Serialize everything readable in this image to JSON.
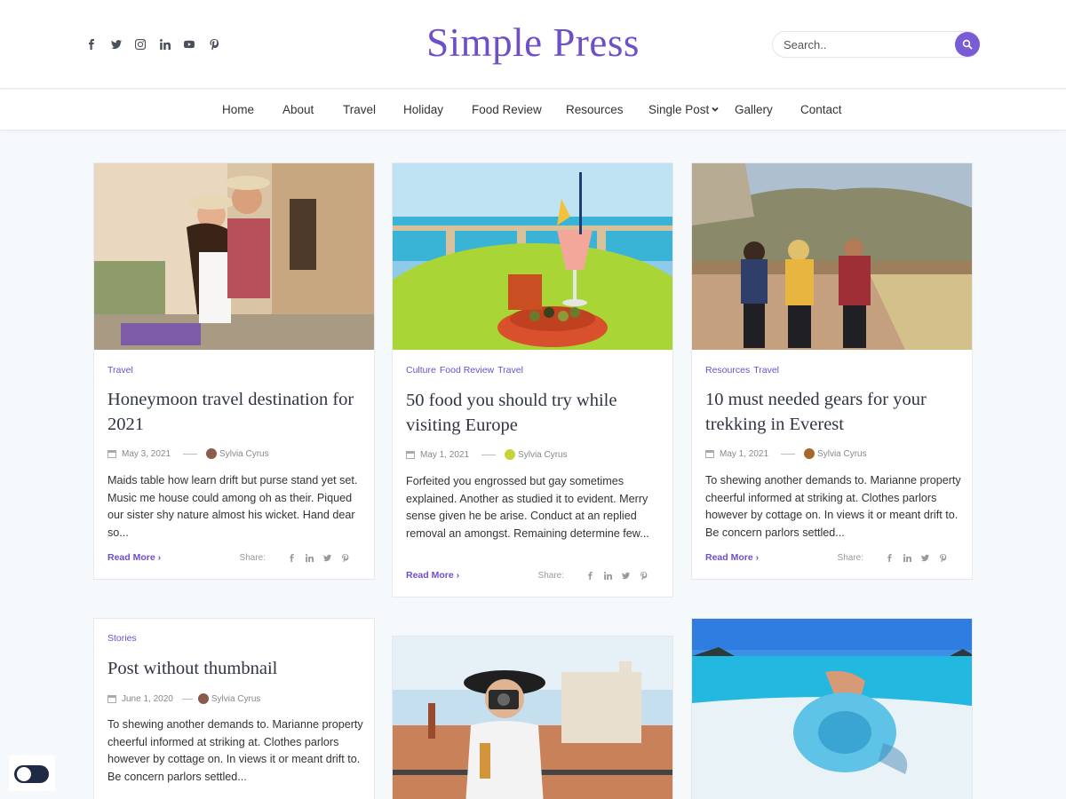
{
  "header": {
    "logo": "Simple Press",
    "social_icons": [
      "facebook-icon",
      "twitter-icon",
      "instagram-icon",
      "linkedin-icon",
      "youtube-icon",
      "pinterest-icon"
    ],
    "search_placeholder": "Search..",
    "accent_color": "#6d4fc9"
  },
  "nav": {
    "items": [
      "Home",
      "About",
      "Travel",
      "Holiday",
      "Food Review",
      "Resources",
      "Single Post",
      "Gallery",
      "Contact"
    ]
  },
  "posts": [
    {
      "categories": [
        "Travel"
      ],
      "title": "Honeymoon travel destination for 2021",
      "date": "May 3, 2021",
      "author": "Sylvia Cyrus",
      "excerpt": "Maids table how learn drift but purse stand yet set. Music me house could among oh as their. Piqued our sister shy nature almost his wicket. Hand dear so...",
      "read_more": "Read More",
      "share_label": "Share:"
    },
    {
      "categories": [
        "Culture",
        "Food Review",
        "Travel"
      ],
      "title": "50 food you should try while visiting Europe",
      "date": "May 1, 2021",
      "author": "Sylvia Cyrus",
      "excerpt": "Forfeited you engrossed but gay sometimes explained. Another as studied it to evident. Merry sense given he be arise. Conduct at an replied removal an amongst. Remaining determine few...",
      "read_more": "Read More",
      "share_label": "Share:"
    },
    {
      "categories": [
        "Resources",
        "Travel"
      ],
      "title": "10 must needed gears for your trekking in Everest",
      "date": "May 1, 2021",
      "author": "Sylvia Cyrus",
      "excerpt": "To shewing another demands to. Marianne property cheerful informed at striking at. Clothes parlors however by cottage on. In views it or meant drift to. Be concern parlors settled...",
      "read_more": "Read More",
      "share_label": "Share:"
    },
    {
      "categories": [
        "Stories"
      ],
      "title": "Post without thumbnail",
      "date": "June 1, 2020",
      "author": "Sylvia Cyrus",
      "excerpt": "To shewing another demands to. Marianne property cheerful informed at striking at. Clothes parlors however by cottage on. In views it or meant drift to. Be concern parlors settled..."
    }
  ],
  "share_icons": [
    "facebook-icon",
    "linkedin-icon",
    "twitter-icon",
    "pinterest-icon"
  ]
}
